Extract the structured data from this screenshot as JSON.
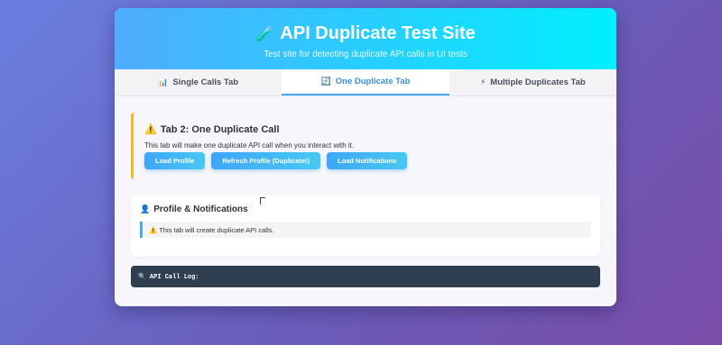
{
  "header": {
    "icon": "test-tube-icon",
    "title": "API Duplicate Test Site",
    "subtitle": "Test site for detecting duplicate API calls in UI tests"
  },
  "tabs": [
    {
      "icon": "chart-icon",
      "label": "Single Calls Tab",
      "active": false
    },
    {
      "icon": "repeat-icon",
      "label": "One Duplicate Tab",
      "active": true
    },
    {
      "icon": "lightning-icon",
      "label": "Multiple Duplicates Tab",
      "active": false
    }
  ],
  "panel": {
    "title": "Tab 2: One Duplicate Call",
    "description": "This tab will make one duplicate API call when you interact with it.",
    "buttons": [
      "Load Profile",
      "Refresh Profile (Duplicate!)",
      "Load Notifications"
    ]
  },
  "card": {
    "title": "Profile & Notifications",
    "notice": "This tab will create duplicate API calls."
  },
  "log": {
    "label": "API Call Log:"
  },
  "colors": {
    "header_start": "#4facfe",
    "header_end": "#00f0fe",
    "accent": "#4aa8f0",
    "warning": "#ffb12a",
    "log_bg": "#2f3e50"
  }
}
